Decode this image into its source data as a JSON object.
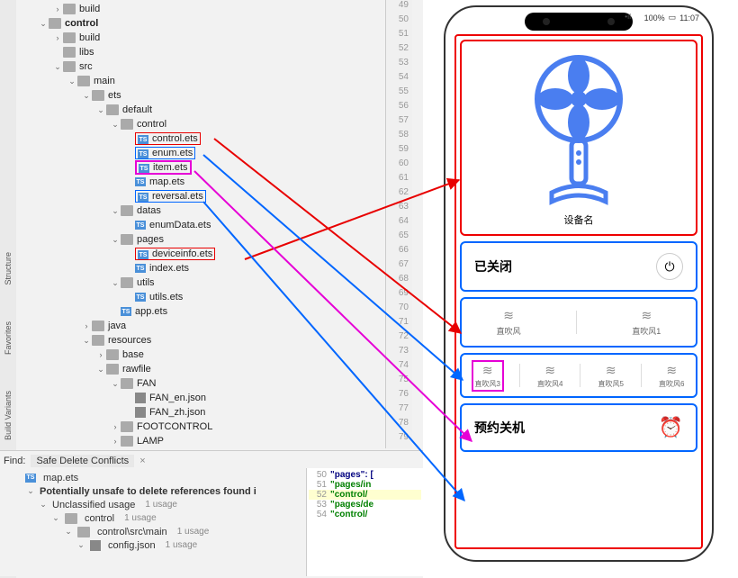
{
  "tree": {
    "build0": "build",
    "control": "control",
    "build": "build",
    "libs": "libs",
    "src": "src",
    "main": "main",
    "ets": "ets",
    "default": "default",
    "control_folder": "control",
    "control_ets": "control.ets",
    "enum_ets": "enum.ets",
    "item_ets": "item.ets",
    "map_ets": "map.ets",
    "reversal_ets": "reversal.ets",
    "datas": "datas",
    "enumData_ets": "enumData.ets",
    "pages": "pages",
    "deviceinfo_ets": "deviceinfo.ets",
    "index_ets": "index.ets",
    "utils_folder": "utils",
    "utils_ets": "utils.ets",
    "app_ets": "app.ets",
    "java": "java",
    "resources": "resources",
    "base": "base",
    "rawfile": "rawfile",
    "fan": "FAN",
    "fan_en": "FAN_en.json",
    "fan_zh": "FAN_zh.json",
    "footcontrol": "FOOTCONTROL",
    "lamp": "LAMP",
    "config_json": "config.json"
  },
  "gutter": [
    "49",
    "50",
    "51",
    "52",
    "53",
    "54",
    "55",
    "56",
    "57",
    "58",
    "59",
    "60",
    "61",
    "62",
    "63",
    "64",
    "65",
    "66",
    "67",
    "68",
    "69",
    "70",
    "71",
    "72",
    "73",
    "74",
    "75",
    "76",
    "77",
    "78",
    "79"
  ],
  "find": {
    "label": "Find:",
    "tab": "Safe Delete Conflicts",
    "map_ets": "map.ets",
    "warning": "Potentially unsafe to delete references found i",
    "unclassified": "Unclassified usage",
    "u1": "1 usage",
    "control": "control",
    "control_main": "control\\src\\main",
    "config": "config.json"
  },
  "code": {
    "l50_num": "50",
    "l50": "\"pages\": [",
    "l51_num": "51",
    "l51": "\"pages/in",
    "l52_num": "52",
    "l52": "\"control/",
    "l53_num": "53",
    "l53": "\"pages/de",
    "l54_num": "54",
    "l54": "\"control/"
  },
  "phone": {
    "signal": "•ıl",
    "wifi_label": "wifi",
    "battery": "100%",
    "time": "11:07",
    "device_name": "设备名",
    "status": "已关闭",
    "power_symbol": "⏻",
    "mode1": "直吹风",
    "mode2": "直吹风1",
    "mode_a": "直吹风3",
    "mode_b": "直吹风4",
    "mode_c": "直吹风5",
    "mode_d": "直吹风6",
    "timer": "预约关机",
    "wave": "≋"
  },
  "left_tabs": {
    "structure": "Structure",
    "favorites": "Favorites",
    "variants": "Build Variants"
  }
}
